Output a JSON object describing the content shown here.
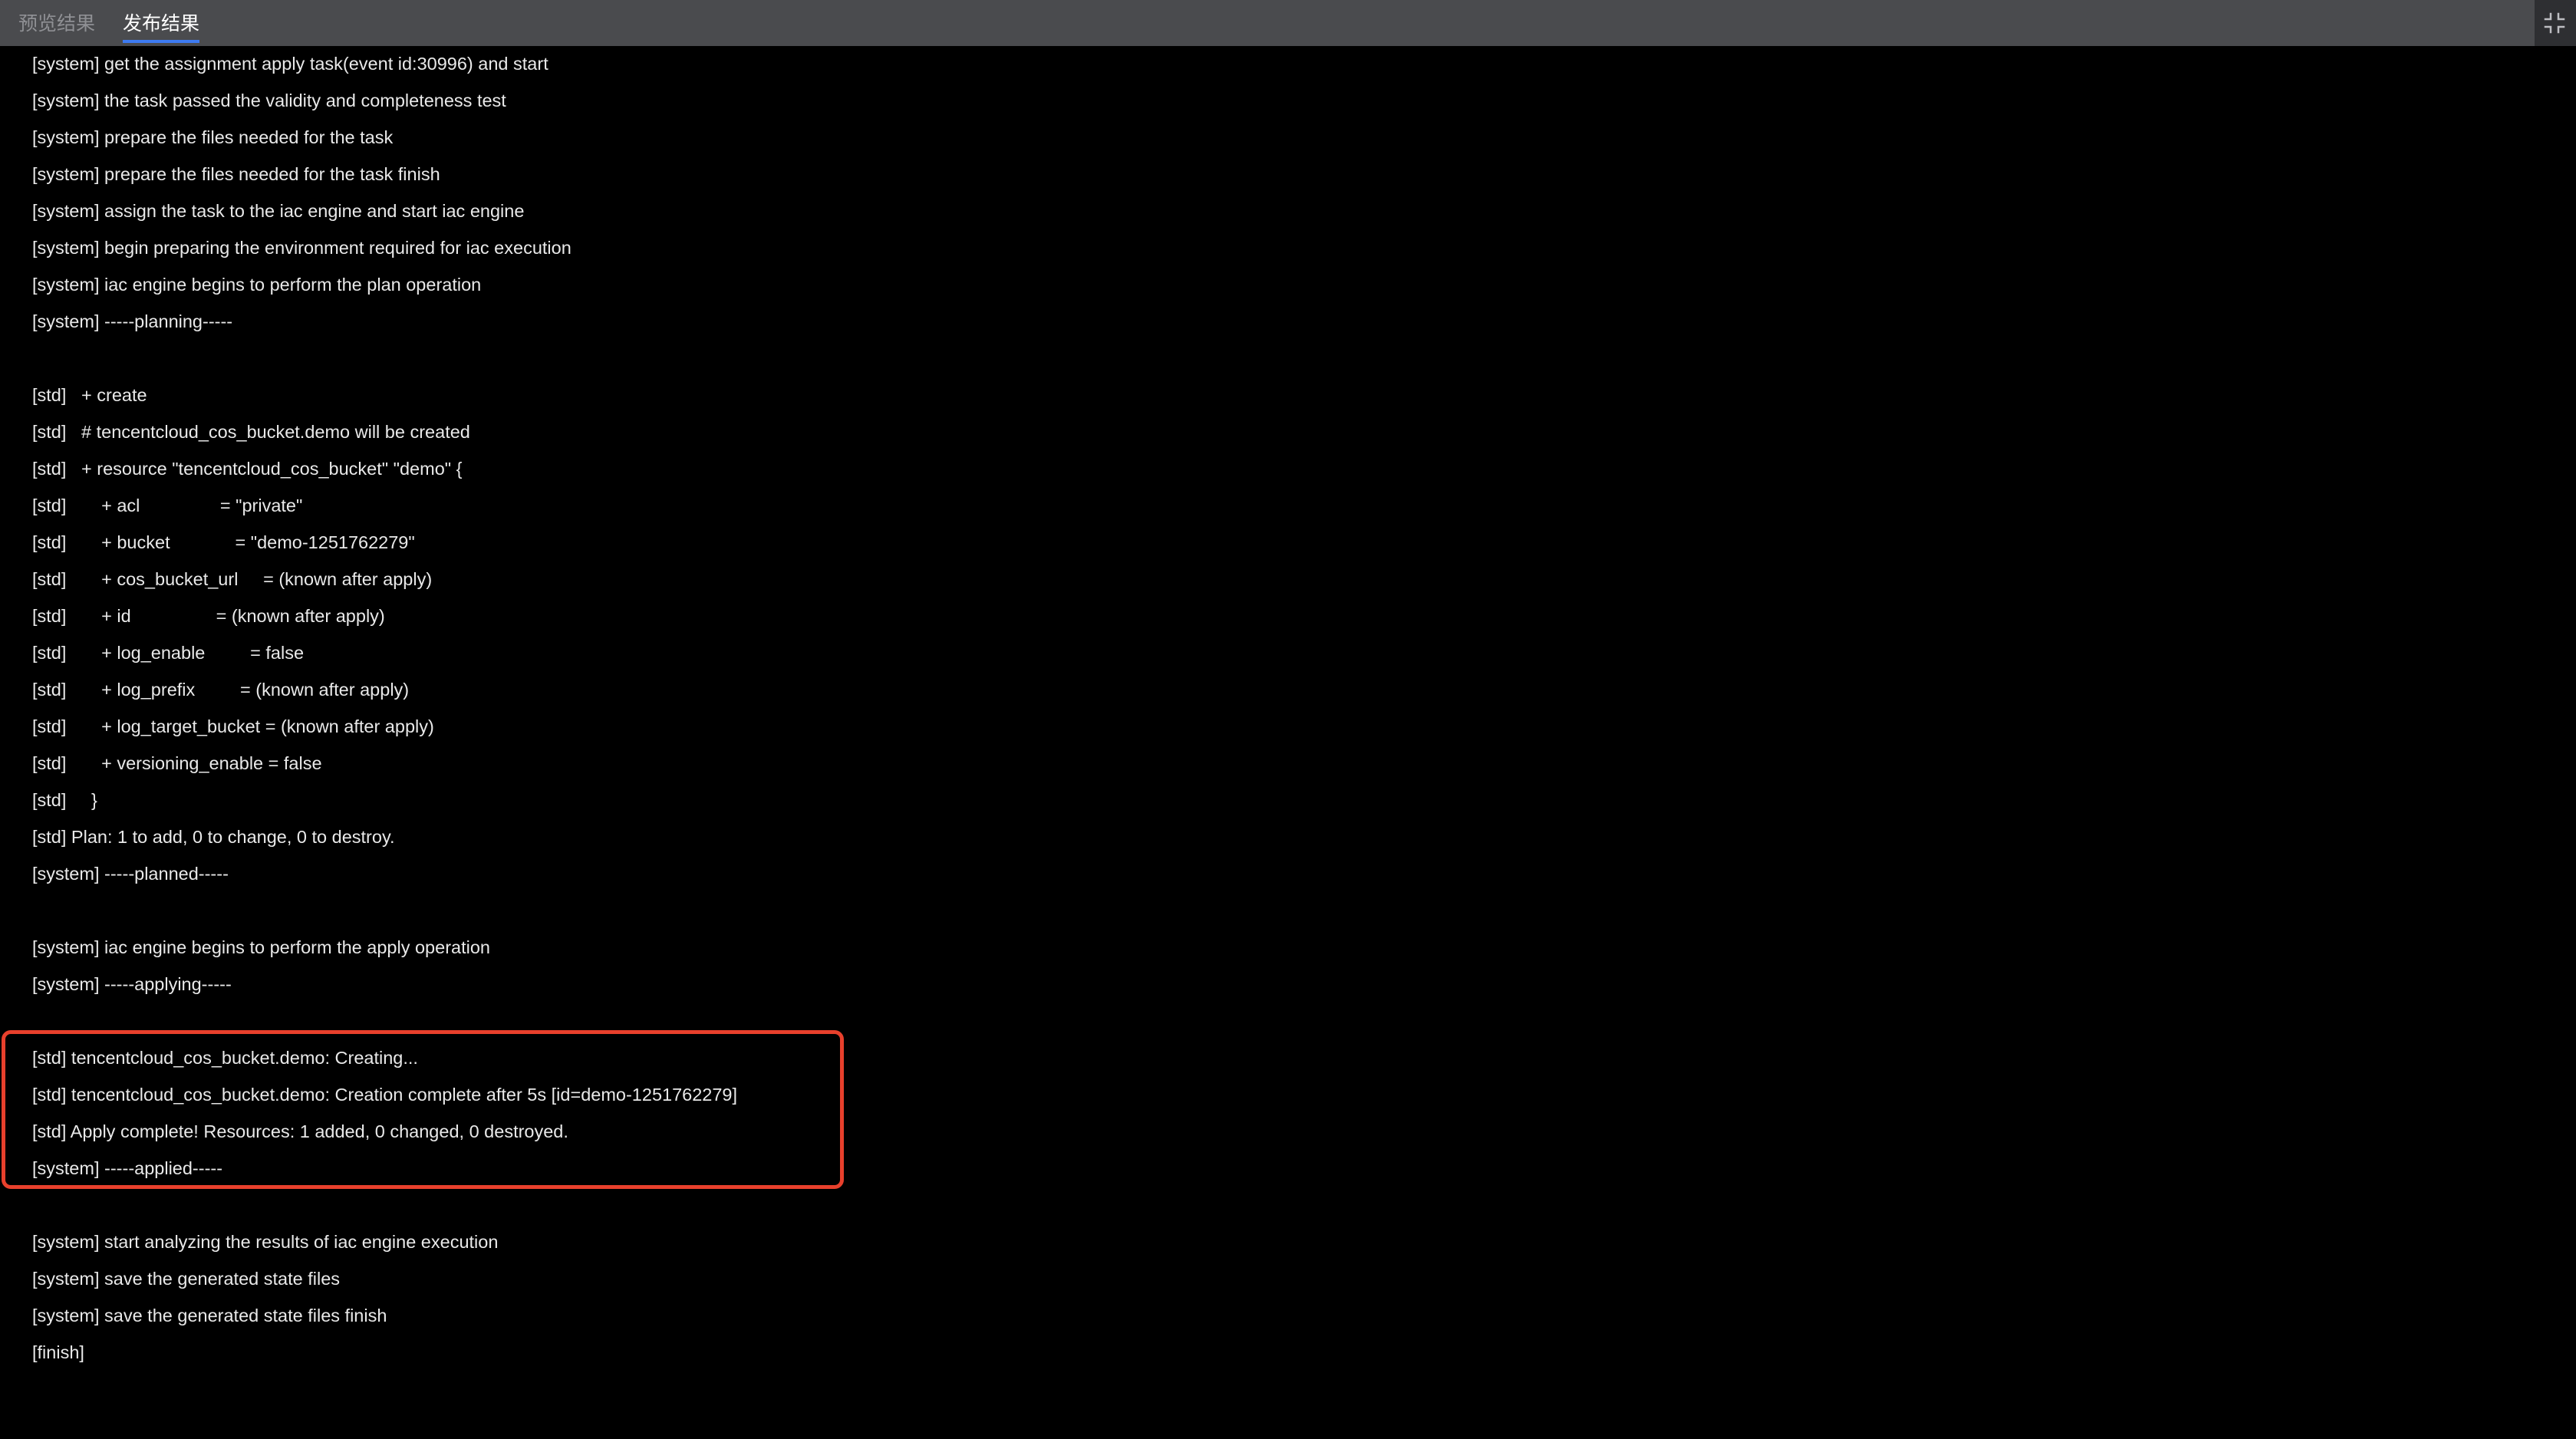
{
  "tabs": [
    {
      "label": "预览结果",
      "active": false
    },
    {
      "label": "发布结果",
      "active": true
    }
  ],
  "collapse_icon": "collapse-icon",
  "colors": {
    "background": "#000000",
    "tabbar": "#4a4b4e",
    "text": "#e9e9e9",
    "active_tab_underline": "#3d7bf2",
    "highlight_border": "#e8402c"
  },
  "log_lines": [
    "[system] get the assignment apply task(event id:30996) and start",
    "[system] the task passed the validity and completeness test",
    "[system] prepare the files needed for the task",
    "[system] prepare the files needed for the task finish",
    "[system] assign the task to the iac engine and start iac engine",
    "[system] begin preparing the environment required for iac execution",
    "[system] iac engine begins to perform the plan operation",
    "[system] -----planning-----",
    "[std]   + create",
    "[std]   # tencentcloud_cos_bucket.demo will be created",
    "[std]   + resource \"tencentcloud_cos_bucket\" \"demo\" {",
    "[std]       + acl                = \"private\"",
    "[std]       + bucket             = \"demo-1251762279\"",
    "[std]       + cos_bucket_url     = (known after apply)",
    "[std]       + id                 = (known after apply)",
    "[std]       + log_enable         = false",
    "[std]       + log_prefix         = (known after apply)",
    "[std]       + log_target_bucket = (known after apply)",
    "[std]       + versioning_enable = false",
    "[std]     }",
    "[std] Plan: 1 to add, 0 to change, 0 to destroy.",
    "[system] -----planned-----",
    "[system] iac engine begins to perform the apply operation",
    "[system] -----applying-----",
    "[std] tencentcloud_cos_bucket.demo: Creating...",
    "[std] tencentcloud_cos_bucket.demo: Creation complete after 5s [id=demo-1251762279]",
    "[std] Apply complete! Resources: 1 added, 0 changed, 0 destroyed.",
    "[system] -----applied-----",
    "[system] start analyzing the results of iac engine execution",
    "[system] save the generated state files",
    "[system] save the generated state files finish",
    "[finish]"
  ]
}
